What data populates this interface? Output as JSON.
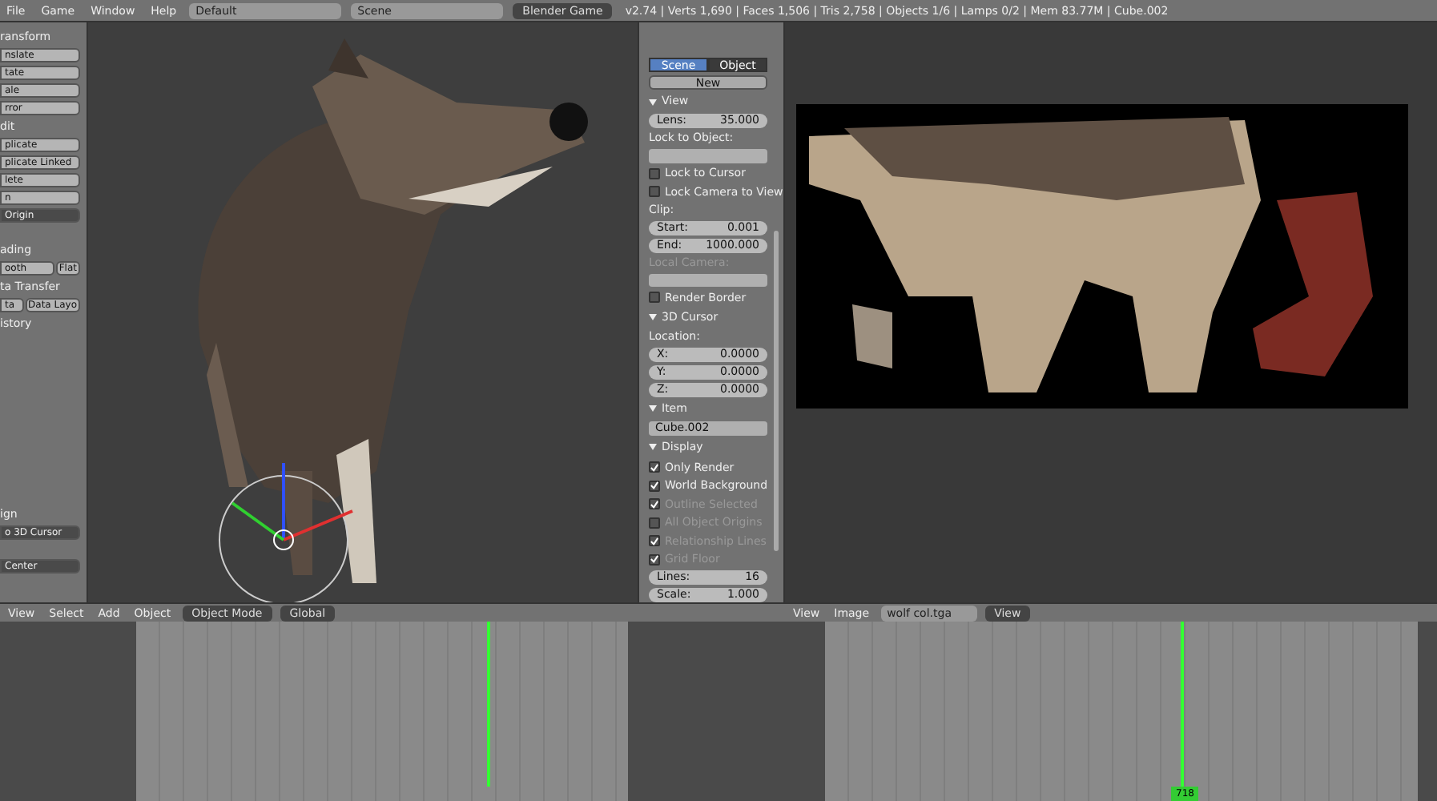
{
  "menu": [
    "File",
    "Game",
    "Window",
    "Help"
  ],
  "screen_layout": "Default",
  "scene": "Scene",
  "engine": "Blender Game",
  "stats": "v2.74 | Verts 1,690 | Faces 1,506 | Tris 2,758 | Objects 1/6 | Lamps 0/2 | Mem 83.77M | Cube.002",
  "tool_shelf": [
    {
      "kind": "label",
      "text": "ransform"
    },
    {
      "kind": "button",
      "text": "nslate"
    },
    {
      "kind": "button",
      "text": "tate"
    },
    {
      "kind": "button",
      "text": "ale"
    },
    {
      "kind": "button",
      "text": "rror"
    },
    {
      "kind": "label",
      "text": "dit"
    },
    {
      "kind": "button",
      "text": "plicate"
    },
    {
      "kind": "button",
      "text": "plicate Linked"
    },
    {
      "kind": "button",
      "text": "lete"
    },
    {
      "kind": "button",
      "text": "n"
    },
    {
      "kind": "dropdown",
      "text": "Origin"
    },
    {
      "kind": "label",
      "text": "ading"
    },
    {
      "kind": "pair",
      "text": "ooth",
      "text2": "Flat"
    },
    {
      "kind": "label",
      "text": "ta Transfer"
    },
    {
      "kind": "pair",
      "text": "ta",
      "text2": "Data Layo"
    },
    {
      "kind": "label",
      "text": "istory"
    },
    {
      "kind": "spacer"
    },
    {
      "kind": "label",
      "text": "ign"
    },
    {
      "kind": "dropdown",
      "text": "o 3D Cursor"
    },
    {
      "kind": "dropdown",
      "text": "Center"
    }
  ],
  "properties": [
    {
      "kind": "tabs",
      "items": [
        {
          "label": "Scene",
          "selected": true
        },
        {
          "label": "Object",
          "selected": false
        }
      ]
    },
    {
      "kind": "button",
      "text": "New"
    },
    {
      "kind": "header",
      "text": "View"
    },
    {
      "kind": "number",
      "text": "Lens:",
      "value": "35.000"
    },
    {
      "kind": "label",
      "text": "Lock to Object:",
      "disabled": false
    },
    {
      "kind": "field"
    },
    {
      "kind": "checkbox",
      "text": "Lock to Cursor",
      "checked": false,
      "disabled": false
    },
    {
      "kind": "checkbox",
      "text": "Lock Camera to View",
      "checked": false,
      "disabled": false
    },
    {
      "kind": "label",
      "text": "Clip:",
      "disabled": false
    },
    {
      "kind": "number",
      "text": "Start:",
      "value": "0.001"
    },
    {
      "kind": "number",
      "text": "End:",
      "value": "1000.000"
    },
    {
      "kind": "label",
      "text": "Local Camera:",
      "disabled": true
    },
    {
      "kind": "field"
    },
    {
      "kind": "checkbox",
      "text": "Render Border",
      "checked": false,
      "disabled": false
    },
    {
      "kind": "header",
      "text": "3D Cursor"
    },
    {
      "kind": "label",
      "text": "Location:",
      "disabled": false
    },
    {
      "kind": "number",
      "text": "X:",
      "value": "0.0000"
    },
    {
      "kind": "number",
      "text": "Y:",
      "value": "0.0000"
    },
    {
      "kind": "number",
      "text": "Z:",
      "value": "0.0000"
    },
    {
      "kind": "header",
      "text": "Item"
    },
    {
      "kind": "field",
      "text": "Cube.002"
    },
    {
      "kind": "header",
      "text": "Display"
    },
    {
      "kind": "checkbox",
      "text": "Only Render",
      "checked": true,
      "disabled": false
    },
    {
      "kind": "checkbox",
      "text": "World Background",
      "checked": true,
      "disabled": false
    },
    {
      "kind": "checkbox",
      "text": "Outline Selected",
      "checked": true,
      "disabled": true
    },
    {
      "kind": "checkbox",
      "text": "All Object Origins",
      "checked": false,
      "disabled": true
    },
    {
      "kind": "checkbox",
      "text": "Relationship Lines",
      "checked": true,
      "disabled": true
    },
    {
      "kind": "checkbox",
      "text": "Grid Floor",
      "checked": true,
      "disabled": true
    },
    {
      "kind": "number",
      "text": "Lines:",
      "value": "16"
    },
    {
      "kind": "number",
      "text": "Scale:",
      "value": "1.000"
    }
  ],
  "viewport_header": {
    "menu": [
      "View",
      "Select",
      "Add",
      "Object"
    ],
    "mode": "Object Mode",
    "orientation": "Global"
  },
  "image_header": {
    "menu": [
      "View",
      "Image"
    ],
    "image": "wolf col.tga",
    "view": "View"
  },
  "timeline_frame": "718"
}
